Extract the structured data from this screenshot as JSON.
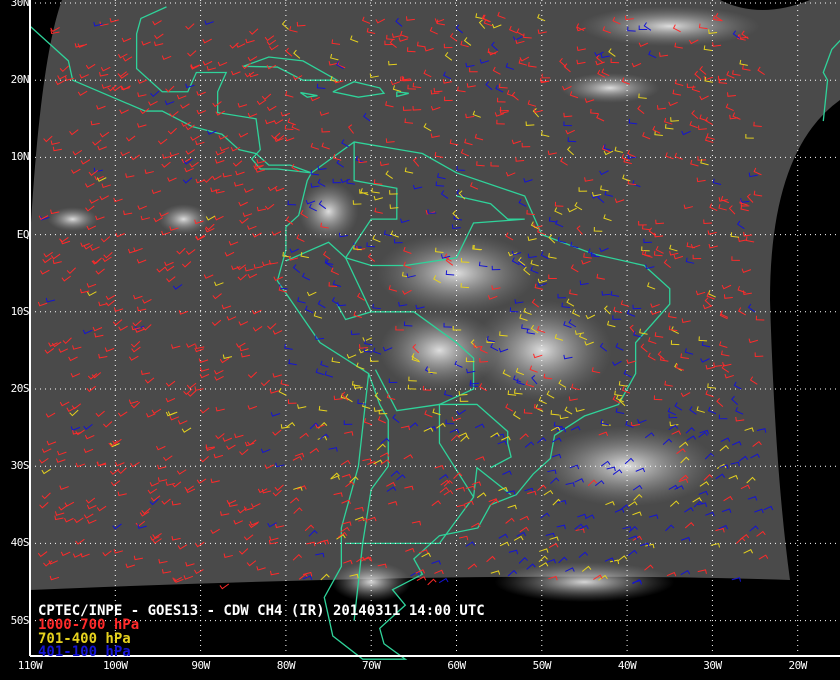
{
  "map": {
    "title": "CPTEC/INPE - GOES13 - CDW CH4 (IR) 20140311 14:00 UTC",
    "legend": [
      {
        "label": "1000-700 hPa",
        "color": "#ff2a2a"
      },
      {
        "label": "701-400 hPa",
        "color": "#e6d21e"
      },
      {
        "label": "401-100 hPa",
        "color": "#1414d2"
      }
    ],
    "lat_labels": [
      "30N",
      "20N",
      "10N",
      "EQ",
      "10S",
      "20S",
      "30S",
      "40S",
      "50S"
    ],
    "lon_labels": [
      "110W",
      "100W",
      "90W",
      "80W",
      "70W",
      "60W",
      "50W",
      "40W",
      "30W",
      "20W"
    ],
    "coastline_color": "#2fd39a",
    "grid": "dotted white"
  }
}
